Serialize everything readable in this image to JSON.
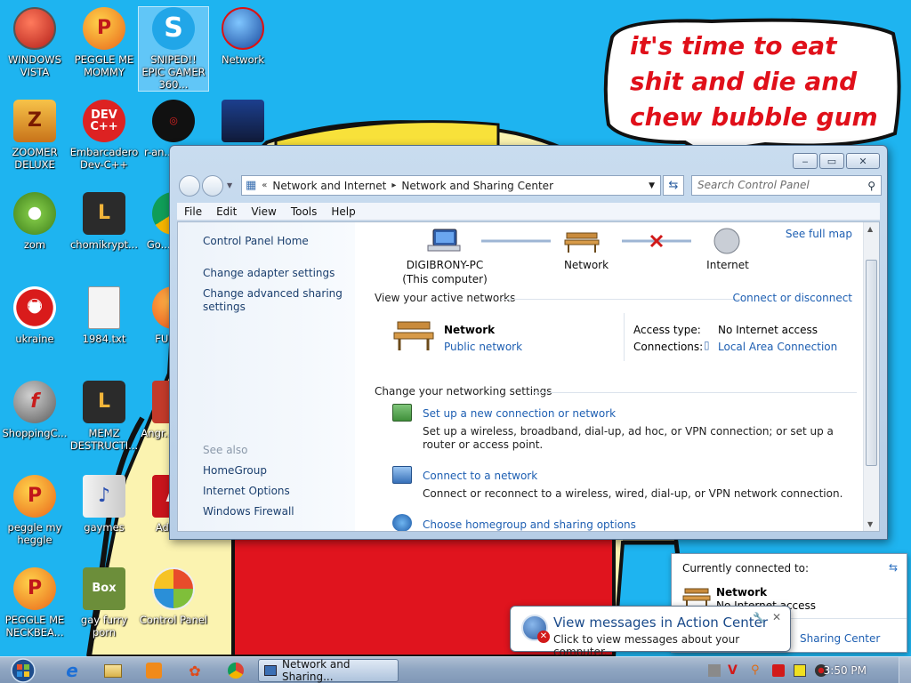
{
  "desktop": {
    "bubble_text": "it's time to eat shit and die and chew bubble gum",
    "icons": [
      {
        "label": "WINDOWS VISTA"
      },
      {
        "label": "PEGGLE ME MOMMY"
      },
      {
        "label": "SNIPED!! EPIC GAMER 360..."
      },
      {
        "label": "Network"
      },
      {
        "label": "ZOOMER DELUXE"
      },
      {
        "label": "Embarcadero Dev-C++"
      },
      {
        "label": "r-an... par..."
      },
      {
        "label": "zom"
      },
      {
        "label": "chomikrypt..."
      },
      {
        "label": "Go... Chr..."
      },
      {
        "label": "ukraine"
      },
      {
        "label": "1984.txt"
      },
      {
        "label": "FURR..."
      },
      {
        "label": "ShoppingC..."
      },
      {
        "label": "MEMZ DESTRUCTI..."
      },
      {
        "label": "Angr... Sea..."
      },
      {
        "label": "peggle my heggle"
      },
      {
        "label": "gaymes"
      },
      {
        "label": "Adob..."
      },
      {
        "label": "PEGGLE ME NECKBEA..."
      },
      {
        "label": "gay furry porn"
      },
      {
        "label": "Control Panel"
      }
    ]
  },
  "window": {
    "breadcrumb": [
      "Network and Internet",
      "Network and Sharing Center"
    ],
    "search_placeholder": "Search Control Panel",
    "menu": [
      "File",
      "Edit",
      "View",
      "Tools",
      "Help"
    ],
    "left_links": [
      "Control Panel Home",
      "Change adapter settings",
      "Change advanced sharing settings"
    ],
    "see_also_header": "See also",
    "see_also": [
      "HomeGroup",
      "Internet Options",
      "Windows Firewall"
    ],
    "map": {
      "see_full_map": "See full map",
      "computer_name": "DIGIBRONY-PC",
      "computer_sub": "(This computer)",
      "network": "Network",
      "internet": "Internet"
    },
    "active": {
      "header": "View your active networks",
      "connect_link": "Connect or disconnect",
      "network_name": "Network",
      "network_type": "Public network",
      "access_label": "Access type:",
      "access_value": "No Internet access",
      "conn_label": "Connections:",
      "conn_value": "Local Area Connection"
    },
    "settings": {
      "header": "Change your networking settings",
      "tasks": [
        {
          "title": "Set up a new connection or network",
          "desc": "Set up a wireless, broadband, dial-up, ad hoc, or VPN connection; or set up a router or access point."
        },
        {
          "title": "Connect to a network",
          "desc": "Connect or reconnect to a wireless, wired, dial-up, or VPN network connection."
        },
        {
          "title": "Choose homegroup and sharing options",
          "desc": ""
        }
      ]
    }
  },
  "netpopup": {
    "header": "Currently connected to:",
    "network": "Network",
    "status": "No Internet access",
    "link": "Sharing Center"
  },
  "action_center": {
    "title": "View messages in Action Center",
    "body": "Click to view messages about your computer."
  },
  "taskbar": {
    "active_item": "Network and Sharing...",
    "clock": "3:50 PM"
  }
}
